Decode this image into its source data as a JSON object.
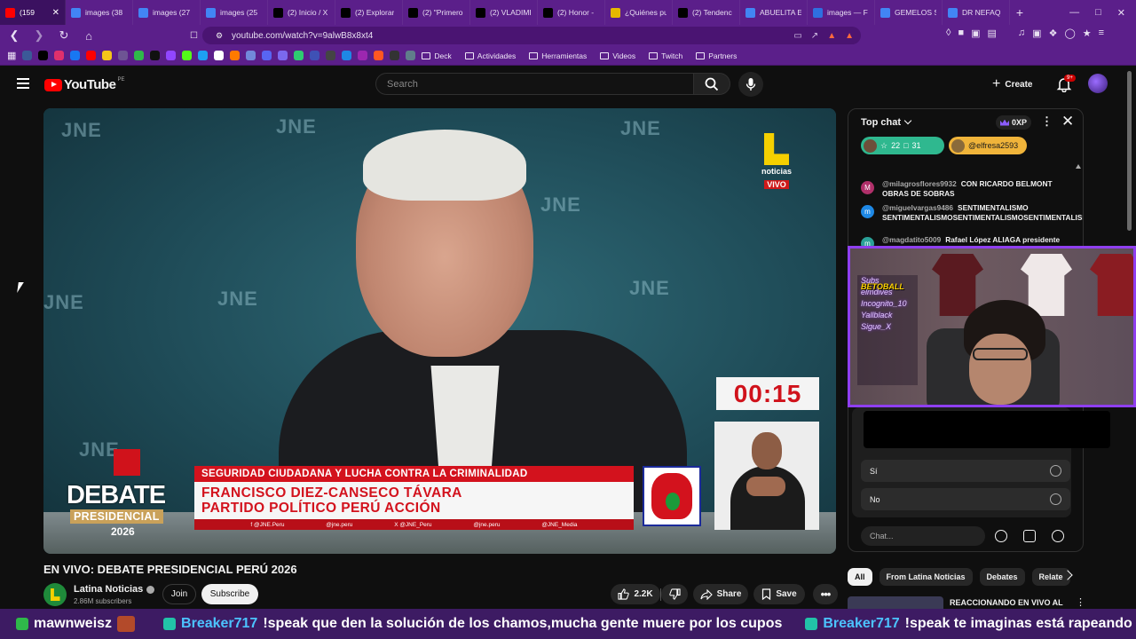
{
  "browser": {
    "tabs": [
      {
        "label": "(159",
        "color": "#ff0000"
      },
      {
        "label": "images (38",
        "color": "#4285f4"
      },
      {
        "label": "images (27",
        "color": "#4285f4"
      },
      {
        "label": "images (25",
        "color": "#4285f4"
      },
      {
        "label": "(2) Inicio / X",
        "color": "#000000"
      },
      {
        "label": "(2) Explorar",
        "color": "#000000"
      },
      {
        "label": "(2) \"Primero",
        "color": "#000000"
      },
      {
        "label": "(2) VLADIMI",
        "color": "#000000"
      },
      {
        "label": "(2) Honor -",
        "color": "#000000"
      },
      {
        "label": "¿Quiénes pu",
        "color": "#e6b800"
      },
      {
        "label": "(2) Tendenc",
        "color": "#000000"
      },
      {
        "label": "ABUELITA E",
        "color": "#4285f4"
      },
      {
        "label": "images — F",
        "color": "#2f6fe0"
      },
      {
        "label": "GEMELOS S",
        "color": "#4285f4"
      },
      {
        "label": "DR NEFAQ",
        "color": "#4285f4"
      }
    ],
    "new_tab": "+",
    "url": "youtube.com/watch?v=9alwB8x8xt4",
    "bookmarks_folders": [
      "Deck",
      "Actividades",
      "Herramientas",
      "Videos",
      "Twitch",
      "Partners"
    ]
  },
  "youtube": {
    "logo_text": "YouTube",
    "country_code": "PE",
    "search_placeholder": "Search",
    "create_label": "Create",
    "notif_count": "9+"
  },
  "video": {
    "watermark": "JNE",
    "channel_logo_label": "noticias",
    "live_label": "VIVO",
    "timer": "00:15",
    "debate_title": "DEBATE",
    "debate_subtitle": "PRESIDENCIAL",
    "debate_year": "2026",
    "debate_emblem": "JNE",
    "topic": "SEGURIDAD CIUDADANA Y LUCHA CONTRA LA CRIMINALIDAD",
    "candidate": "FRANCISCO DIEZ-CANSECO TÁVARA",
    "party": "PARTIDO POLÍTICO PERÚ ACCIÓN",
    "socials": [
      "f @JNE.Peru",
      "@jne.peru",
      "X @JNE_Peru",
      "@jne.peru",
      "@JNE_Media"
    ]
  },
  "meta": {
    "title": "EN VIVO: DEBATE PRESIDENCIAL PERÚ 2026",
    "channel": "Latina Noticias",
    "subscribers": "2.86M subscribers",
    "join": "Join",
    "subscribe": "Subscribe",
    "likes": "2.2K",
    "share": "Share",
    "save": "Save"
  },
  "chat": {
    "header": "Top chat",
    "xp": "0XP",
    "ticker_green_a": "22",
    "ticker_green_b": "31",
    "ticker_yellow": "@elfresa2593",
    "messages": [
      {
        "user": "@milagrosflores9932",
        "text": "CON RICARDO BELMONT OBRAS DE SOBRAS",
        "avatar": "M",
        "color": "#b0306a"
      },
      {
        "user": "@miguelvargas9486",
        "text": "SENTIMENTALISMO SENTIMENTALISMOSENTIMENTALISMOSENTIMENTALISMO",
        "avatar": "m",
        "color": "#1e88e5"
      },
      {
        "user": "@magdatito5009",
        "text": "Rafael López ALIAGA presidente",
        "avatar": "m",
        "color": "#2aa198"
      }
    ],
    "poll_options": [
      "Sí",
      "No"
    ],
    "input_placeholder": "Chat..."
  },
  "webcam": {
    "brand": "BETOBALL",
    "board_lines": [
      "Subs",
      "elmdives",
      "Incognito_10",
      "Yallblack",
      "Sigue_X"
    ]
  },
  "related": {
    "chips": [
      "All",
      "From Latina Noticias",
      "Debates",
      "Relate"
    ],
    "rec_title": "REACCIONANDO EN VIVO AL"
  },
  "stream_ticker": [
    {
      "user": "mawnweisz",
      "msg": "",
      "badge": "#2fb84a",
      "plain": true
    },
    {
      "user": "Breaker717",
      "msg": "!speak que den la solución de los chamos,mucha gente muere por los cupos",
      "badge": "#22c3a8",
      "plain": false
    },
    {
      "user": "Breaker717",
      "msg": "!speak te imaginas está rapeando el de señas?",
      "badge": "#22c3a8",
      "plain": false
    }
  ]
}
